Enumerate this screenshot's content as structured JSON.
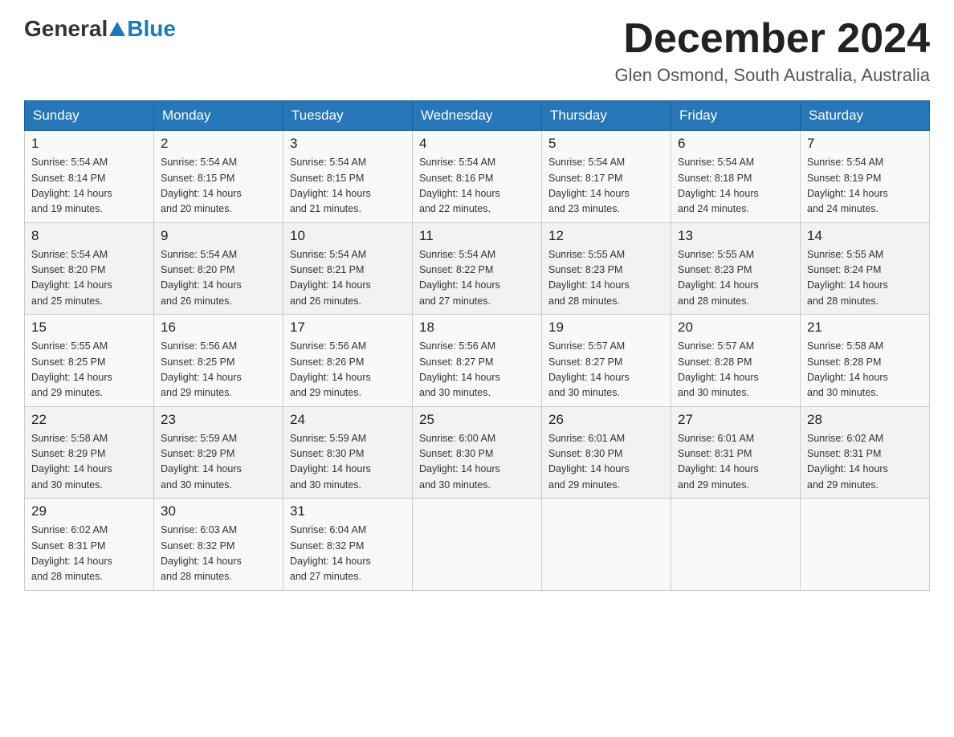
{
  "header": {
    "logo_general": "General",
    "logo_blue": "Blue",
    "month_title": "December 2024",
    "location": "Glen Osmond, South Australia, Australia"
  },
  "weekdays": [
    "Sunday",
    "Monday",
    "Tuesday",
    "Wednesday",
    "Thursday",
    "Friday",
    "Saturday"
  ],
  "weeks": [
    [
      {
        "day": "1",
        "sunrise": "5:54 AM",
        "sunset": "8:14 PM",
        "daylight": "14 hours and 19 minutes."
      },
      {
        "day": "2",
        "sunrise": "5:54 AM",
        "sunset": "8:15 PM",
        "daylight": "14 hours and 20 minutes."
      },
      {
        "day": "3",
        "sunrise": "5:54 AM",
        "sunset": "8:15 PM",
        "daylight": "14 hours and 21 minutes."
      },
      {
        "day": "4",
        "sunrise": "5:54 AM",
        "sunset": "8:16 PM",
        "daylight": "14 hours and 22 minutes."
      },
      {
        "day": "5",
        "sunrise": "5:54 AM",
        "sunset": "8:17 PM",
        "daylight": "14 hours and 23 minutes."
      },
      {
        "day": "6",
        "sunrise": "5:54 AM",
        "sunset": "8:18 PM",
        "daylight": "14 hours and 24 minutes."
      },
      {
        "day": "7",
        "sunrise": "5:54 AM",
        "sunset": "8:19 PM",
        "daylight": "14 hours and 24 minutes."
      }
    ],
    [
      {
        "day": "8",
        "sunrise": "5:54 AM",
        "sunset": "8:20 PM",
        "daylight": "14 hours and 25 minutes."
      },
      {
        "day": "9",
        "sunrise": "5:54 AM",
        "sunset": "8:20 PM",
        "daylight": "14 hours and 26 minutes."
      },
      {
        "day": "10",
        "sunrise": "5:54 AM",
        "sunset": "8:21 PM",
        "daylight": "14 hours and 26 minutes."
      },
      {
        "day": "11",
        "sunrise": "5:54 AM",
        "sunset": "8:22 PM",
        "daylight": "14 hours and 27 minutes."
      },
      {
        "day": "12",
        "sunrise": "5:55 AM",
        "sunset": "8:23 PM",
        "daylight": "14 hours and 28 minutes."
      },
      {
        "day": "13",
        "sunrise": "5:55 AM",
        "sunset": "8:23 PM",
        "daylight": "14 hours and 28 minutes."
      },
      {
        "day": "14",
        "sunrise": "5:55 AM",
        "sunset": "8:24 PM",
        "daylight": "14 hours and 28 minutes."
      }
    ],
    [
      {
        "day": "15",
        "sunrise": "5:55 AM",
        "sunset": "8:25 PM",
        "daylight": "14 hours and 29 minutes."
      },
      {
        "day": "16",
        "sunrise": "5:56 AM",
        "sunset": "8:25 PM",
        "daylight": "14 hours and 29 minutes."
      },
      {
        "day": "17",
        "sunrise": "5:56 AM",
        "sunset": "8:26 PM",
        "daylight": "14 hours and 29 minutes."
      },
      {
        "day": "18",
        "sunrise": "5:56 AM",
        "sunset": "8:27 PM",
        "daylight": "14 hours and 30 minutes."
      },
      {
        "day": "19",
        "sunrise": "5:57 AM",
        "sunset": "8:27 PM",
        "daylight": "14 hours and 30 minutes."
      },
      {
        "day": "20",
        "sunrise": "5:57 AM",
        "sunset": "8:28 PM",
        "daylight": "14 hours and 30 minutes."
      },
      {
        "day": "21",
        "sunrise": "5:58 AM",
        "sunset": "8:28 PM",
        "daylight": "14 hours and 30 minutes."
      }
    ],
    [
      {
        "day": "22",
        "sunrise": "5:58 AM",
        "sunset": "8:29 PM",
        "daylight": "14 hours and 30 minutes."
      },
      {
        "day": "23",
        "sunrise": "5:59 AM",
        "sunset": "8:29 PM",
        "daylight": "14 hours and 30 minutes."
      },
      {
        "day": "24",
        "sunrise": "5:59 AM",
        "sunset": "8:30 PM",
        "daylight": "14 hours and 30 minutes."
      },
      {
        "day": "25",
        "sunrise": "6:00 AM",
        "sunset": "8:30 PM",
        "daylight": "14 hours and 30 minutes."
      },
      {
        "day": "26",
        "sunrise": "6:01 AM",
        "sunset": "8:30 PM",
        "daylight": "14 hours and 29 minutes."
      },
      {
        "day": "27",
        "sunrise": "6:01 AM",
        "sunset": "8:31 PM",
        "daylight": "14 hours and 29 minutes."
      },
      {
        "day": "28",
        "sunrise": "6:02 AM",
        "sunset": "8:31 PM",
        "daylight": "14 hours and 29 minutes."
      }
    ],
    [
      {
        "day": "29",
        "sunrise": "6:02 AM",
        "sunset": "8:31 PM",
        "daylight": "14 hours and 28 minutes."
      },
      {
        "day": "30",
        "sunrise": "6:03 AM",
        "sunset": "8:32 PM",
        "daylight": "14 hours and 28 minutes."
      },
      {
        "day": "31",
        "sunrise": "6:04 AM",
        "sunset": "8:32 PM",
        "daylight": "14 hours and 27 minutes."
      },
      null,
      null,
      null,
      null
    ]
  ],
  "labels": {
    "sunrise": "Sunrise:",
    "sunset": "Sunset:",
    "daylight": "Daylight:"
  }
}
